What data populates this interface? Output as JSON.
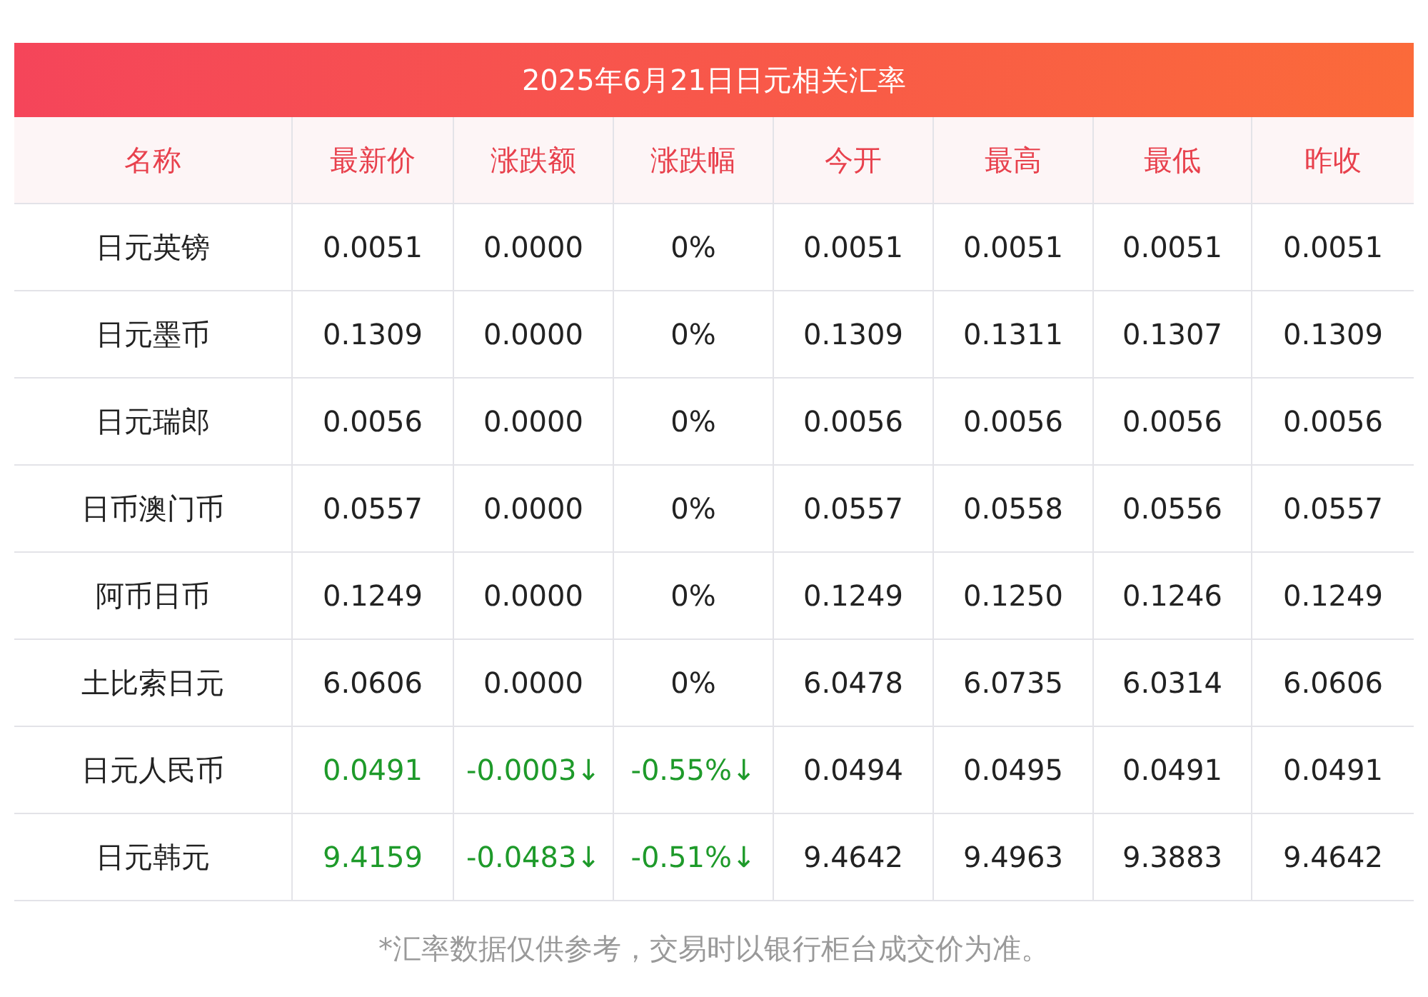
{
  "title": "2025年6月21日日元相关汇率",
  "columns": [
    "名称",
    "最新价",
    "涨跌额",
    "涨跌幅",
    "今开",
    "最高",
    "最低",
    "昨收"
  ],
  "rows": [
    {
      "color": "#222222",
      "cells": [
        "日元英镑",
        "0.0051",
        "0.0000",
        "0%",
        "0.0051",
        "0.0051",
        "0.0051",
        "0.0051"
      ]
    },
    {
      "color": "#222222",
      "cells": [
        "日元墨币",
        "0.1309",
        "0.0000",
        "0%",
        "0.1309",
        "0.1311",
        "0.1307",
        "0.1309"
      ]
    },
    {
      "color": "#222222",
      "cells": [
        "日元瑞郎",
        "0.0056",
        "0.0000",
        "0%",
        "0.0056",
        "0.0056",
        "0.0056",
        "0.0056"
      ]
    },
    {
      "color": "#222222",
      "cells": [
        "日币澳门币",
        "0.0557",
        "0.0000",
        "0%",
        "0.0557",
        "0.0558",
        "0.0556",
        "0.0557"
      ]
    },
    {
      "color": "#222222",
      "cells": [
        "阿币日币",
        "0.1249",
        "0.0000",
        "0%",
        "0.1249",
        "0.1250",
        "0.1246",
        "0.1249"
      ]
    },
    {
      "color": "#222222",
      "cells": [
        "土比索日元",
        "6.0606",
        "0.0000",
        "0%",
        "6.0478",
        "6.0735",
        "6.0314",
        "6.0606"
      ]
    },
    {
      "color": "#1e9a2a",
      "cells": [
        "日元人民币",
        "0.0491",
        "-0.0003↓",
        "-0.55%↓",
        "0.0494",
        "0.0495",
        "0.0491",
        "0.0491"
      ]
    },
    {
      "color": "#1e9a2a",
      "cells": [
        "日元韩元",
        "9.4159",
        "-0.0483↓",
        "-0.51%↓",
        "9.4642",
        "9.4963",
        "9.3883",
        "9.4642"
      ]
    }
  ],
  "footnote": "*汇率数据仅供参考，交易时以银行柜台成交价为准。"
}
